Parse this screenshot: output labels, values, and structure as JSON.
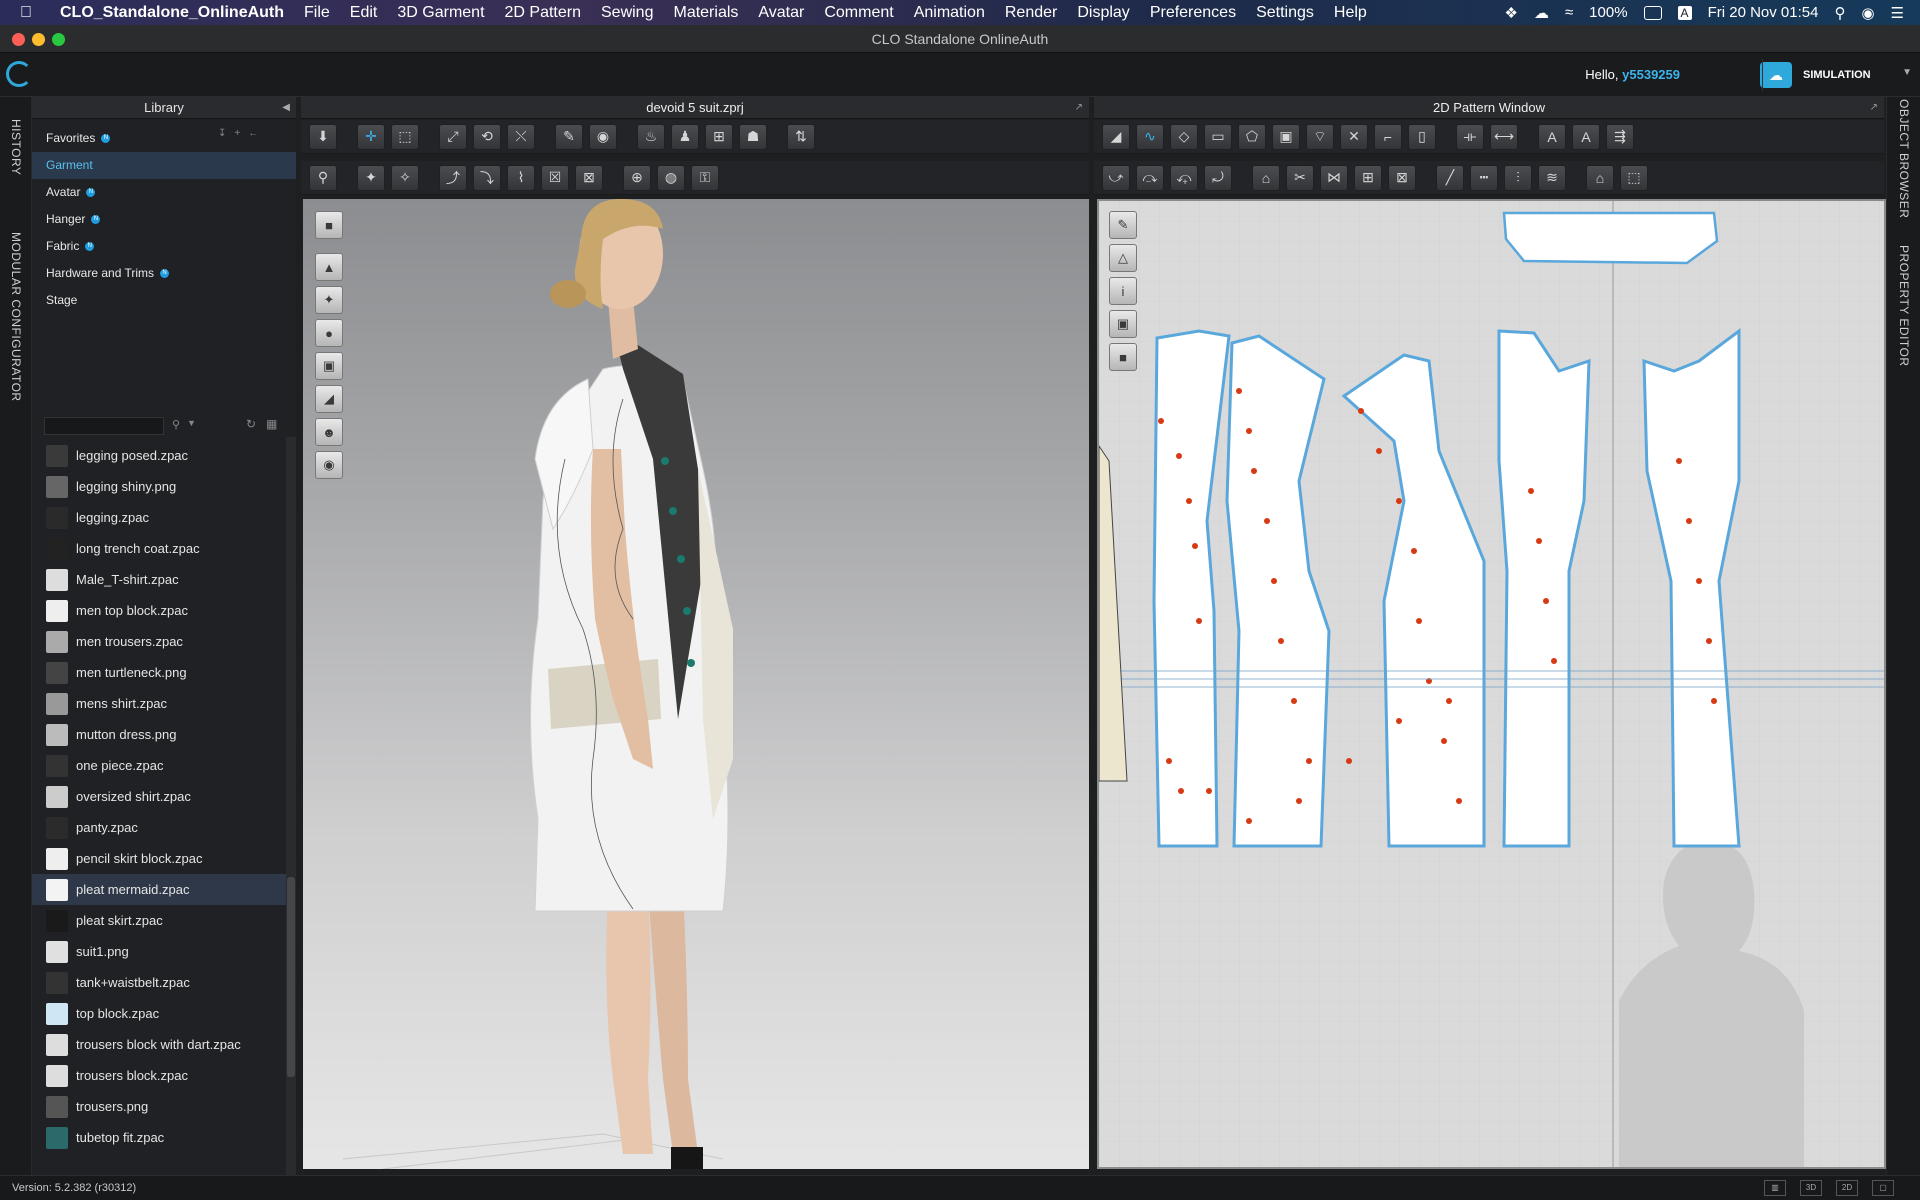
{
  "menubar": {
    "app": "CLO_Standalone_OnlineAuth",
    "items": [
      "File",
      "Edit",
      "3D Garment",
      "2D Pattern",
      "Sewing",
      "Materials",
      "Avatar",
      "Comment",
      "Animation",
      "Render",
      "Display",
      "Preferences",
      "Settings",
      "Help"
    ],
    "battery": "100%",
    "clock": "Fri 20 Nov  01:54",
    "input_source": "A"
  },
  "window": {
    "title": "CLO Standalone OnlineAuth"
  },
  "header": {
    "hello_prefix": "Hello,",
    "username": "y5539259",
    "simulation_label": "SIMULATION"
  },
  "left_strip": {
    "history": "HISTORY",
    "modular": "MODULAR CONFIGURATOR"
  },
  "right_strip": {
    "object_browser": "OBJECT BROWSER",
    "property_editor": "PROPERTY EDITOR"
  },
  "library": {
    "title": "Library",
    "categories": [
      {
        "label": "Favorites",
        "badge": true
      },
      {
        "label": "Garment",
        "badge": false,
        "selected": true
      },
      {
        "label": "Avatar",
        "badge": true
      },
      {
        "label": "Hanger",
        "badge": true
      },
      {
        "label": "Fabric",
        "badge": true
      },
      {
        "label": "Hardware and Trims",
        "badge": true
      },
      {
        "label": "Stage",
        "badge": false
      }
    ],
    "files": [
      "legging posed.zpac",
      "legging shiny.png",
      "legging.zpac",
      "long trench coat.zpac",
      "Male_T-shirt.zpac",
      "men top block.zpac",
      "men trousers.zpac",
      "men turtleneck.png",
      "mens shirt.zpac",
      "mutton dress.png",
      "one piece.zpac",
      "oversized shirt.zpac",
      "panty.zpac",
      "pencil skirt block.zpac",
      "pleat mermaid.zpac",
      "pleat skirt.zpac",
      "suit1.png",
      "tank+waistbelt.zpac",
      "top block.zpac",
      "trousers block with dart.zpac",
      "trousers block.zpac",
      "trousers.png",
      "tubetop fit.zpac"
    ],
    "selected_file": "pleat mermaid.zpac"
  },
  "view3d": {
    "title": "devoid 5 suit.zprj"
  },
  "view2d": {
    "title": "2D Pattern Window"
  },
  "status": {
    "version": "Version: 5.2.382 (r30312)",
    "btn_3d": "3D",
    "btn_2d": "2D"
  },
  "colors": {
    "accent": "#2fa8dc",
    "pattern_outline": "#5aa7dc",
    "point_red": "#d73a12"
  }
}
